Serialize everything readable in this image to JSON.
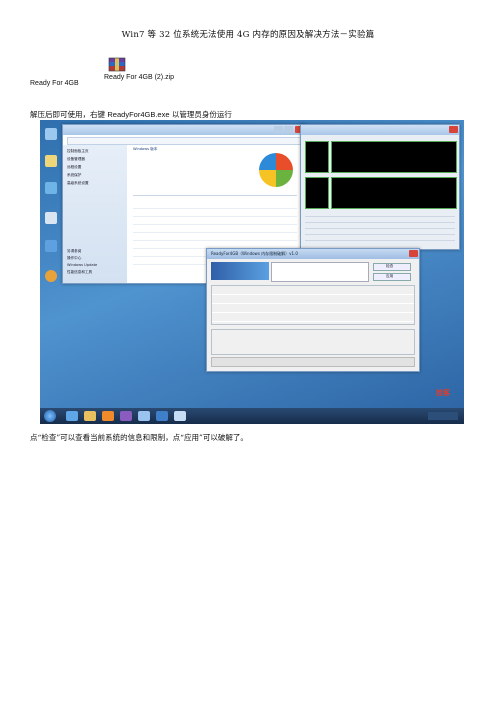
{
  "title": "Win7 等 32 位系统无法使用 4G 内存的原因及解决方法－实验篇",
  "file_label": "Ready For 4GB",
  "attachment": {
    "name": "Ready For 4GB (2).zip",
    "icon": "winrar-archive-icon"
  },
  "instruction": {
    "part1": "解压后即可使用，右键 ",
    "exe": "ReadyFor4GB.exe",
    "part2": " 以管理员身份运行"
  },
  "screenshot": {
    "system_window_header": "Windows 版本",
    "app_title": "ReadyFor4GB（Windows 内存限制破解）v1.0",
    "side_menu": [
      "控制面板主页",
      "设备管理器",
      "远程设置",
      "系统保护",
      "高级系统设置"
    ],
    "see_also": [
      "另请参阅",
      "操作中心",
      "Windows Update",
      "性能信息和工具"
    ],
    "app_buttons": [
      "检查",
      "应用"
    ],
    "watermark": "捡客"
  },
  "caption": "点“检查”可以查看当前系统的信息和限制，点“应用”可以破解了。"
}
